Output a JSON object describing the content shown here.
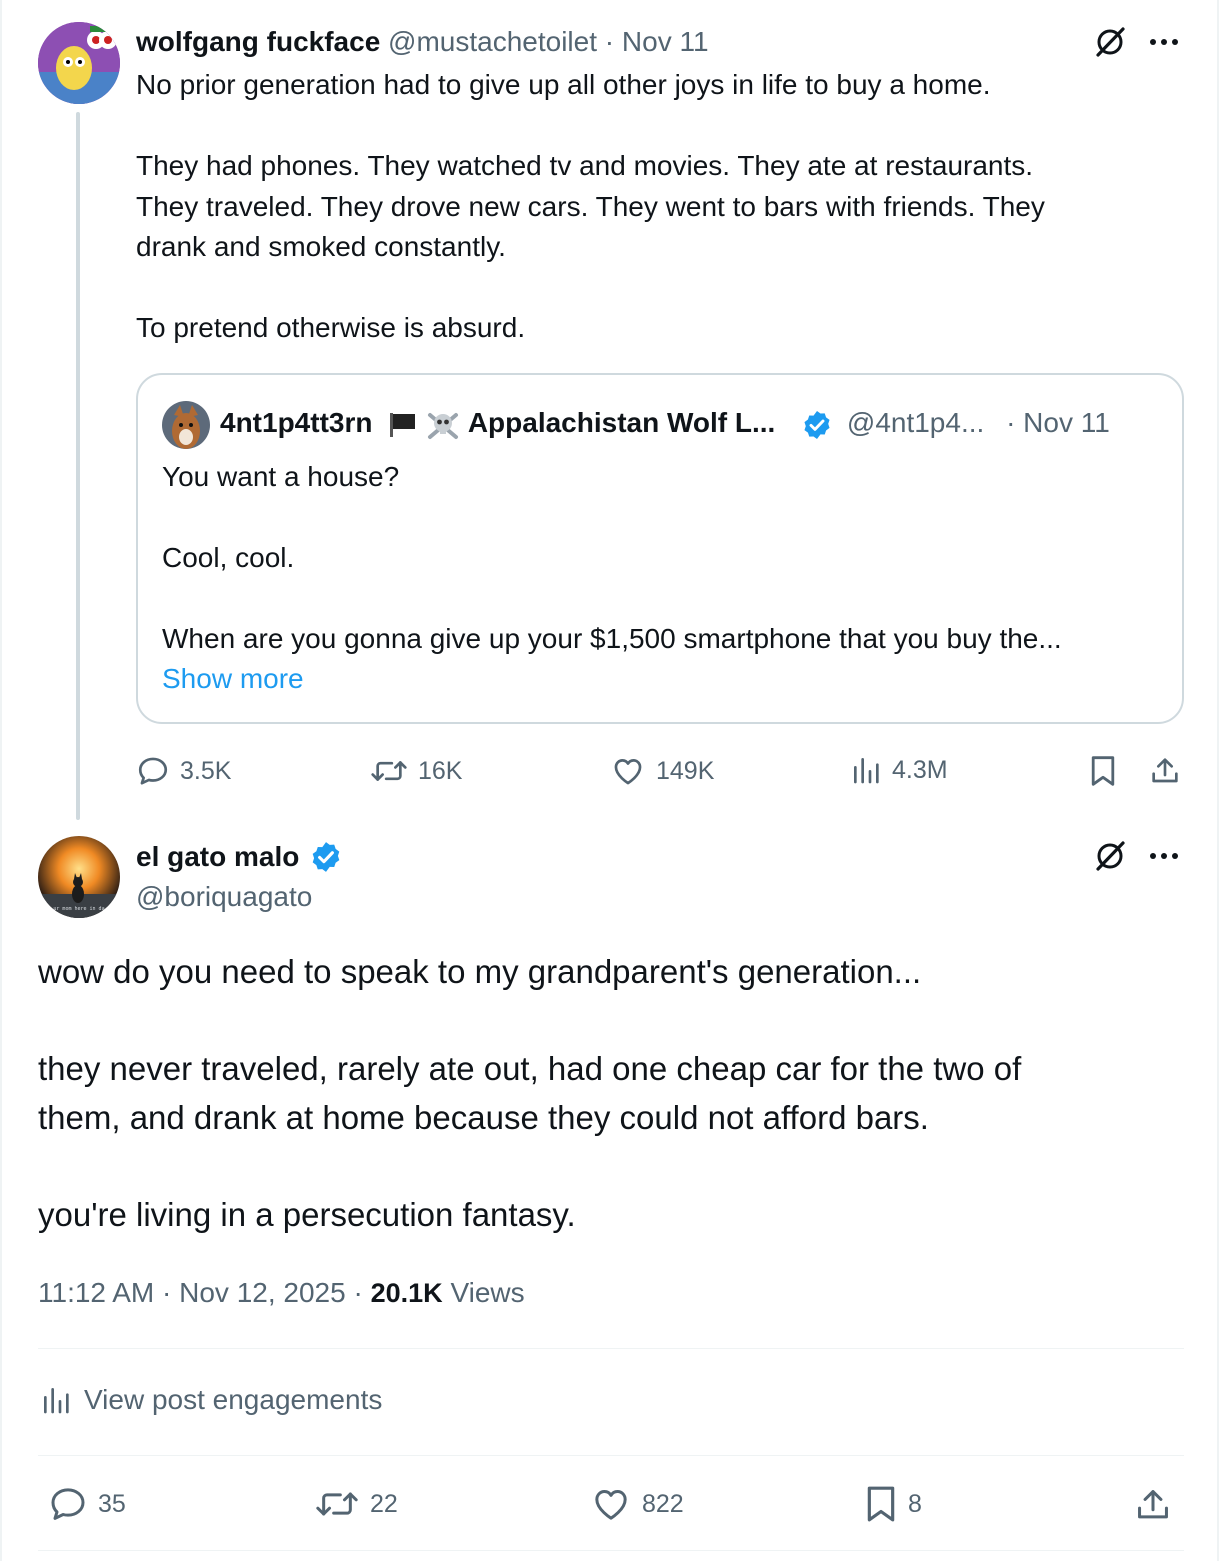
{
  "parent_post": {
    "author_name": "wolfgang fuckface",
    "handle": "@mustachetoilet",
    "date_sep": "·",
    "date": "Nov 11",
    "text": "No prior generation had to give up all other joys in life to buy a home.\n\nThey had phones. They watched tv and movies. They ate at restaurants.\nThey traveled. They drove new cars. They went to bars with friends. They\ndrank and smoked constantly.\n\nTo pretend otherwise is absurd.",
    "quoted": {
      "author_name": "4nt1p4tt3rn",
      "author_suffix": "Appalachistan Wolf L...",
      "handle": "@4nt1p4...",
      "date": "· Nov 11",
      "text": "You want a house?\n\nCool, cool.\n\nWhen are you gonna give up your $1,500 smartphone that you buy the...",
      "show_more": "Show more"
    },
    "stats": {
      "replies": "3.5K",
      "reposts": "16K",
      "likes": "149K",
      "views": "4.3M"
    }
  },
  "main_post": {
    "author_name": "el gato malo",
    "handle": "@boriquagato",
    "avatar_caption": "ur mom here in da",
    "text": "wow do you need to speak to my grandparent's generation...\n\nthey never traveled, rarely ate out, had one cheap car for the two of\nthem, and drank at home because they could not afford bars.\n\nyou're living in a persecution fantasy.",
    "time": "11:12 AM",
    "sep1": "·",
    "date": "Nov 12, 2025",
    "sep2": "·",
    "views_count": "20.1K",
    "views_label": "Views",
    "engagements_label": "View post engagements",
    "stats": {
      "replies": "35",
      "reposts": "22",
      "likes": "822",
      "bookmarks": "8"
    }
  },
  "colors": {
    "accent": "#1d9bf0",
    "muted": "#536471",
    "text": "#0f1419",
    "border": "#cfd9de"
  },
  "icons": [
    "grok-icon",
    "more-icon",
    "reply-icon",
    "repost-icon",
    "like-icon",
    "views-icon",
    "bookmark-icon",
    "share-icon",
    "verified-badge-icon",
    "black-flag-icon",
    "skull-crossbones-icon"
  ]
}
